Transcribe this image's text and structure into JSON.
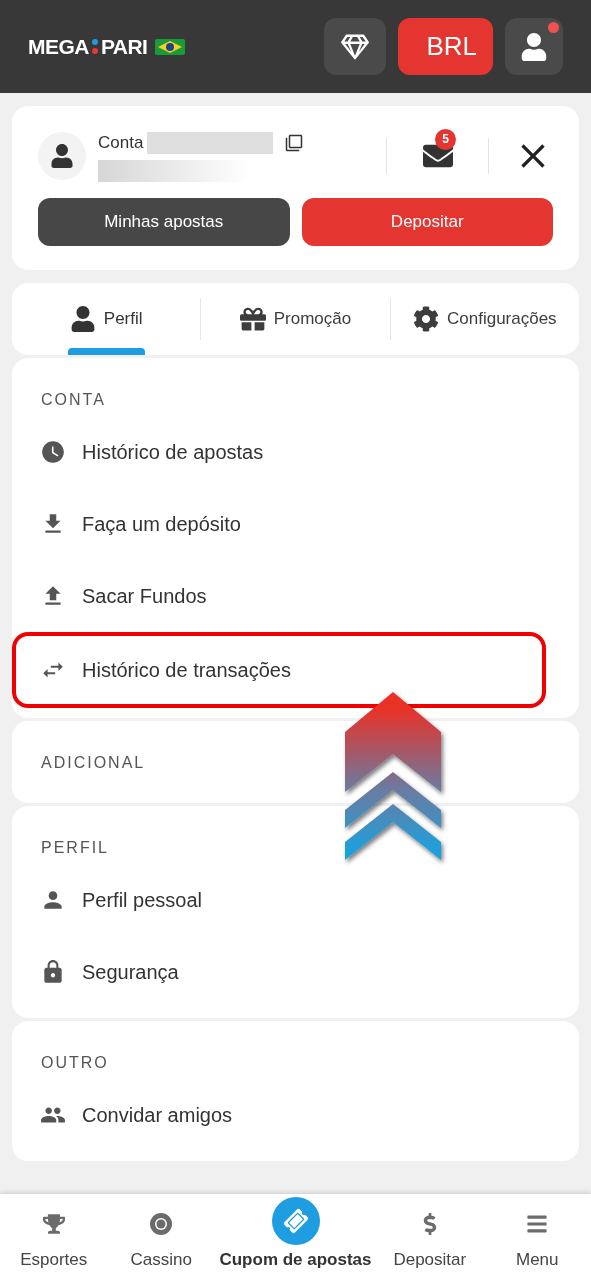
{
  "header": {
    "logo_left": "MEGA",
    "logo_right": "PARI",
    "currency": "BRL",
    "profile_notification": true
  },
  "account": {
    "label": "Conta",
    "messages_count": "5",
    "buttons": [
      {
        "label": "Minhas apostas",
        "kind": "dark"
      },
      {
        "label": "Depositar",
        "kind": "primary"
      }
    ]
  },
  "tabs": [
    {
      "label": "Perfil",
      "selected": true
    },
    {
      "label": "Promoção",
      "selected": false
    },
    {
      "label": "Configurações",
      "selected": false
    }
  ],
  "sections": [
    {
      "title": "CONTA",
      "items": [
        {
          "label": "Histórico de apostas",
          "highlighted": false
        },
        {
          "label": "Faça um depósito",
          "highlighted": false
        },
        {
          "label": "Sacar Fundos",
          "highlighted": false
        },
        {
          "label": "Histórico de transações",
          "highlighted": true
        }
      ]
    },
    {
      "title": "ADICIONAL"
    },
    {
      "title": "PERFIL",
      "items": [
        {
          "label": "Perfil pessoal",
          "highlighted": false
        },
        {
          "label": "Segurança",
          "highlighted": false
        }
      ]
    },
    {
      "title": "OUTRO",
      "items": [
        {
          "label": "Convidar amigos",
          "highlighted": false
        }
      ]
    }
  ],
  "bottom_nav": [
    {
      "label": "Esportes",
      "selected": false
    },
    {
      "label": "Cassino",
      "selected": false
    },
    {
      "label": "Cupom de apostas",
      "selected": true
    },
    {
      "label": "Depositar",
      "selected": false
    },
    {
      "label": "Menu",
      "selected": false
    }
  ]
}
